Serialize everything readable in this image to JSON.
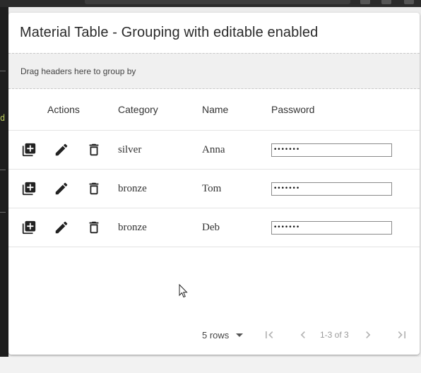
{
  "table": {
    "title": "Material Table - Grouping with editable enabled",
    "group_hint": "Drag headers here to group by",
    "columns": {
      "actions": "Actions",
      "category": "Category",
      "name": "Name",
      "password": "Password"
    },
    "rows": [
      {
        "category": "silver",
        "name": "Anna",
        "password": "•••••••"
      },
      {
        "category": "bronze",
        "name": "Tom",
        "password": "•••••••"
      },
      {
        "category": "bronze",
        "name": "Deb",
        "password": "•••••••"
      }
    ],
    "row_actions": [
      "library-add-icon",
      "edit-icon",
      "delete-icon"
    ]
  },
  "pagination": {
    "rows_per_page": "5 rows",
    "range": "1-3 of 3",
    "buttons": [
      "first-page-icon",
      "previous-page-icon",
      "next-page-icon",
      "last-page-icon"
    ]
  },
  "host": {
    "left_glyph": "d"
  },
  "colors": {
    "card": "#ffffff",
    "group_bar": "#f0f0f0",
    "icon": "#222222",
    "disabled_icon": "#b3b3b3"
  }
}
